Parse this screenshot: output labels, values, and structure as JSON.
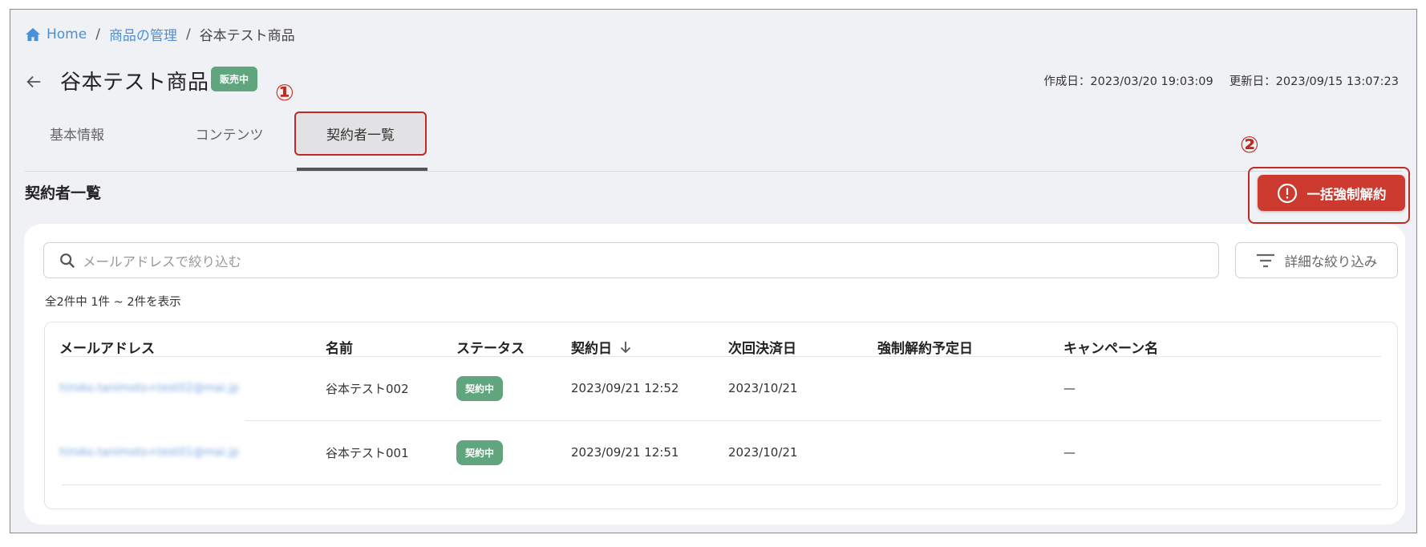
{
  "breadcrumb": {
    "home": "Home",
    "parent": "商品の管理",
    "current": "谷本テスト商品",
    "separator": "/"
  },
  "header": {
    "title": "谷本テスト商品",
    "badge": "販売中",
    "created": "作成日：2023/03/20 19:03:09",
    "updated": "更新日：2023/09/15 13:07:23"
  },
  "tabs": [
    {
      "label": "基本情報"
    },
    {
      "label": "コンテンツ"
    },
    {
      "label": "契約者一覧",
      "active": true
    }
  ],
  "annotations": {
    "one": "①",
    "two": "②"
  },
  "section": {
    "title": "契約者一覧"
  },
  "actions": {
    "bulk_cancel_label": "一括強制解約"
  },
  "search": {
    "placeholder": "メールアドレスで絞り込む"
  },
  "filter": {
    "label": "詳細な絞り込み"
  },
  "result_count": "全2件中 1件 ~ 2件を表示",
  "table": {
    "columns": [
      "メールアドレス",
      "名前",
      "ステータス",
      "契約日",
      "次回決済日",
      "強制解約予定日",
      "キャンペーン名"
    ],
    "rows": [
      {
        "email": "hiroko.tanimoto+test02@mai.jp",
        "name": "谷本テスト002",
        "status": "契約中",
        "contract_date": "2023/09/21 12:52",
        "next_payment": "2023/10/21",
        "cancel_date": "",
        "campaign": "—"
      },
      {
        "email": "hiroko.tanimoto+test01@mai.jp",
        "name": "谷本テスト001",
        "status": "契約中",
        "contract_date": "2023/09/21 12:51",
        "next_payment": "2023/10/21",
        "cancel_date": "",
        "campaign": "—"
      }
    ]
  },
  "colors": {
    "accent_link": "#4a90d9",
    "badge_green": "#5fa57d",
    "danger": "#cc3a2f",
    "annotation_red": "#c02a20"
  },
  "icons": {
    "home": "home-icon",
    "back": "arrow-left-icon",
    "alert": "alert-circle-icon",
    "search": "search-icon",
    "filter": "filter-icon",
    "sort": "arrow-down-icon"
  }
}
